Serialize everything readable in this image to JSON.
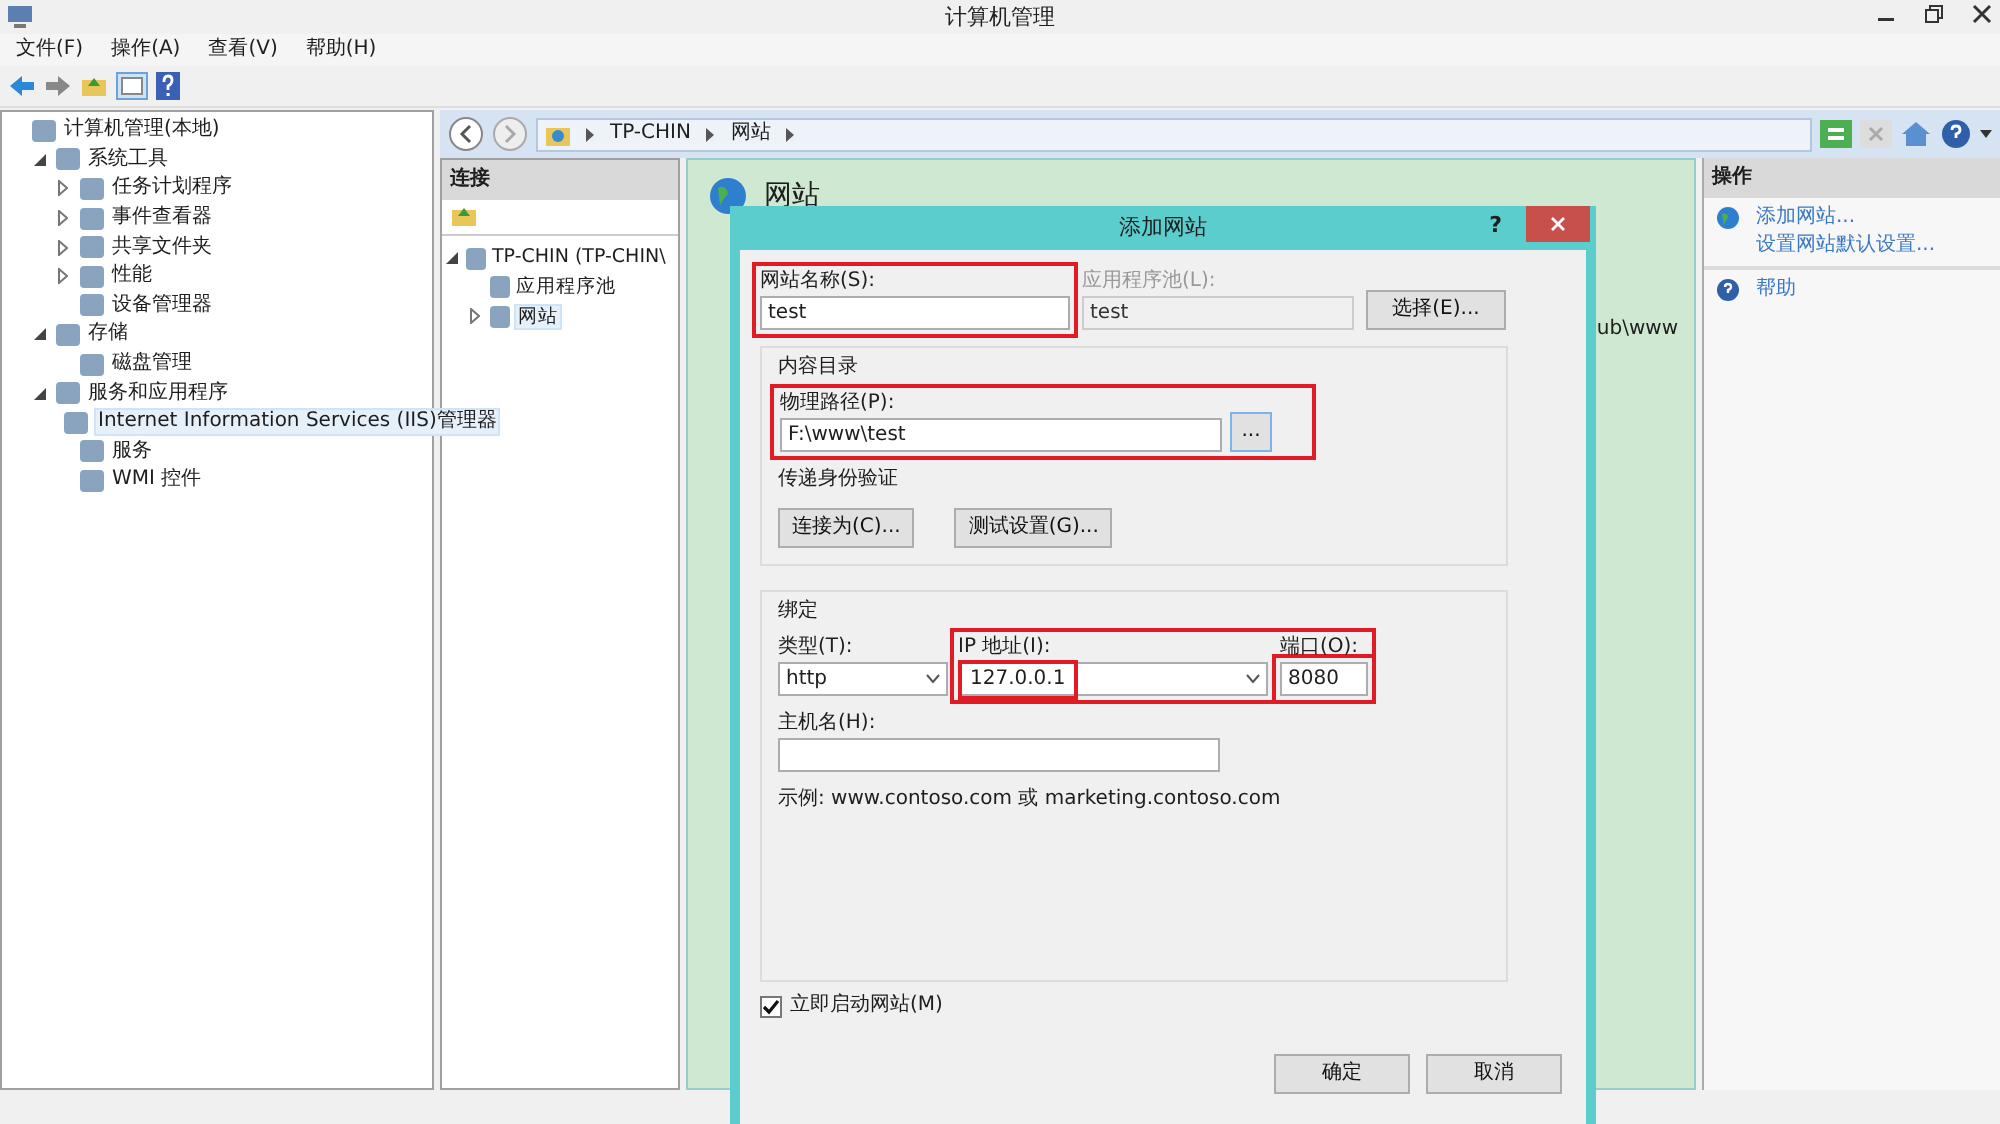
{
  "window": {
    "title": "计算机管理"
  },
  "menu": [
    "文件(F)",
    "操作(A)",
    "查看(V)",
    "帮助(H)"
  ],
  "tree": [
    {
      "label": "计算机管理(本地)",
      "selected": false,
      "children": [
        {
          "label": "系统工具",
          "expanded": true,
          "selected": false,
          "children": [
            {
              "label": "任务计划程序",
              "expanded": false,
              "selected": false
            },
            {
              "label": "事件查看器",
              "expanded": false,
              "selected": false
            },
            {
              "label": "共享文件夹",
              "expanded": false,
              "selected": false
            },
            {
              "label": "性能",
              "expanded": false,
              "selected": false
            },
            {
              "label": "设备管理器",
              "selected": false
            }
          ]
        },
        {
          "label": "存储",
          "expanded": true,
          "selected": false,
          "children": [
            {
              "label": "磁盘管理",
              "selected": false
            }
          ]
        },
        {
          "label": "服务和应用程序",
          "expanded": true,
          "selected": false,
          "children": [
            {
              "label": "Internet Information Services (IIS)管理器",
              "selected": true
            },
            {
              "label": "服务",
              "selected": false
            },
            {
              "label": "WMI 控件",
              "selected": false
            }
          ]
        }
      ]
    }
  ],
  "iis": {
    "breadcrumb": [
      "TP-CHIN",
      "网站"
    ],
    "connections": {
      "header": "连接",
      "tree": [
        {
          "label": "TP-CHIN (TP-CHIN\\",
          "expanded": true,
          "selected": false,
          "children": [
            {
              "label": "应用程序池",
              "selected": false
            },
            {
              "label": "网站",
              "expanded": false,
              "selected": true
            }
          ]
        }
      ]
    },
    "center": {
      "title": "网站",
      "cell": "ub\\www"
    },
    "actions": {
      "header": "操作",
      "groups": [
        [
          "添加网站...",
          "设置网站默认设置..."
        ],
        [
          "帮助"
        ]
      ]
    }
  },
  "dialog": {
    "title": "添加网站",
    "help": "?",
    "site_name": {
      "label": "网站名称(S):",
      "value": "test",
      "highlighted": true
    },
    "app_pool": {
      "label": "应用程序池(L):",
      "value": "test",
      "disabled": true
    },
    "select_button": "选择(E)...",
    "content_directory": {
      "legend": "内容目录",
      "physical_path": {
        "label": "物理路径(P):",
        "value": "F:\\www\\test",
        "highlighted": true
      },
      "browse_button": "...",
      "auth_label": "传递身份验证",
      "buttons": [
        "连接为(C)...",
        "测试设置(G)..."
      ]
    },
    "binding": {
      "legend": "绑定",
      "type": {
        "label": "类型(T):",
        "value": "http"
      },
      "ip_group_highlighted": true,
      "ip": {
        "label": "IP 地址(I):",
        "value": "127.0.0.1",
        "highlighted": true
      },
      "port": {
        "label": "端口(O):",
        "value": "8080",
        "highlighted": true
      },
      "host": {
        "label": "主机名(H):"
      },
      "example": "示例: www.contoso.com 或 marketing.contoso.com"
    },
    "start_now": {
      "label": "立即启动网站(M)",
      "checked": true
    },
    "buttons": [
      "确定",
      "取消"
    ]
  }
}
